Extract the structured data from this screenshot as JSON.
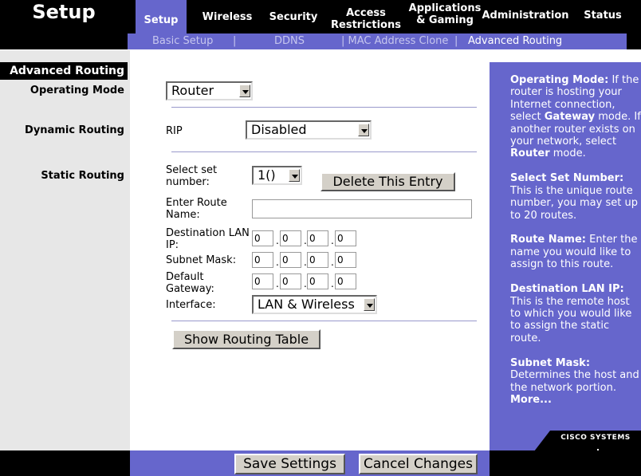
{
  "header": {
    "title": "Setup",
    "tabs": [
      {
        "label": "Setup",
        "active": true
      },
      {
        "label": "Wireless"
      },
      {
        "label": "Security"
      },
      {
        "label_line1": "Access",
        "label_line2": "Restrictions"
      },
      {
        "label_line1": "Applications",
        "label_line2": "& Gaming"
      },
      {
        "label": "Administration"
      },
      {
        "label": "Status"
      }
    ],
    "subnav": {
      "basic_setup": "Basic Setup",
      "sep1": "|",
      "ddns": "DDNS",
      "mac_clone": "| MAC Address Clone",
      "sep2": "|",
      "advanced_routing": "Advanced Routing"
    }
  },
  "section": {
    "title": "Advanced Routing",
    "operating_mode_label": "Operating Mode",
    "dynamic_routing_label": "Dynamic Routing",
    "static_routing_label": "Static Routing"
  },
  "form": {
    "operating_mode_value": "Router",
    "rip_label": "RIP",
    "rip_value": "Disabled",
    "select_set_label_1": "Select set",
    "select_set_label_2": "number:",
    "set_number_value": "1()",
    "delete_button": "Delete This Entry",
    "route_name_label_1": "Enter Route",
    "route_name_label_2": "Name:",
    "route_name_value": "",
    "dest_lan_label_1": "Destination LAN",
    "dest_lan_label_2": "IP:",
    "dest_lan_ip": [
      "0",
      "0",
      "0",
      "0"
    ],
    "subnet_label": "Subnet Mask:",
    "subnet_mask": [
      "0",
      "0",
      "0",
      "0"
    ],
    "gateway_label_1": "Default",
    "gateway_label_2": "Gateway:",
    "gateway": [
      "0",
      "0",
      "0",
      "0"
    ],
    "interface_label": "Interface:",
    "interface_value": "LAN & Wireless",
    "show_table_button": "Show Routing Table",
    "ip_separator": "."
  },
  "help": {
    "op_title": "Operating Mode:",
    "op_text_1": " If the router is hosting your Internet connection, select ",
    "op_gateway": "Gateway",
    "op_text_2": " mode. If another router exists on your network, select ",
    "op_router": "Router",
    "op_text_3": " mode.",
    "set_title": "Select Set Number:",
    "set_text": "This is the unique route number, you may set up to 20 routes.",
    "route_title": "Route Name:",
    "route_text": " Enter the name you would like to assign to this route.",
    "dest_title": "Destination LAN IP:",
    "dest_text": "This is the remote host to which you would like to assign the static route.",
    "mask_title": "Subnet Mask:",
    "mask_text": "Determines the host and the network portion.",
    "more": "More..."
  },
  "footer": {
    "save_button": "Save Settings",
    "cancel_button": "Cancel Changes"
  },
  "brand": {
    "name": "CISCO SYSTEMS"
  },
  "colors": {
    "accent": "#6666cc",
    "header": "#000000",
    "left_column": "#e7e7e7"
  }
}
